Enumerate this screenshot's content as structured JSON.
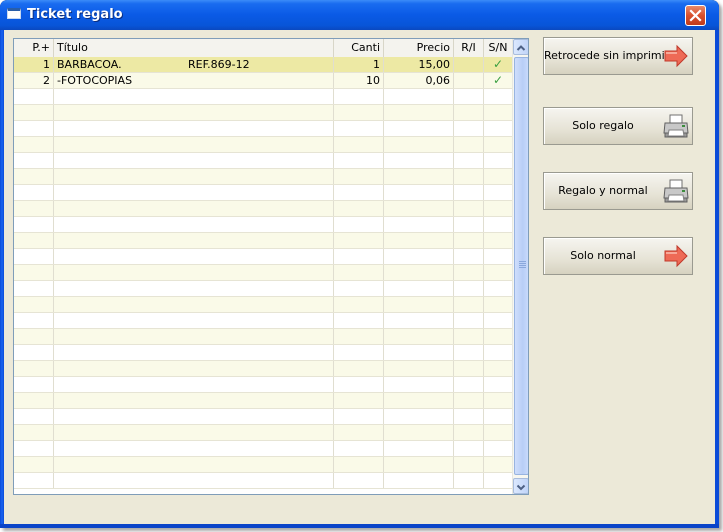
{
  "window": {
    "title": "Ticket regalo"
  },
  "grid": {
    "columns": [
      "P.+",
      "Título",
      "Canti",
      "Precio",
      "R/I",
      "S/N"
    ],
    "rows": [
      {
        "p": "1",
        "titulo": "BARBACOA.",
        "ref": "REF.869-12",
        "canti": "1",
        "precio": "15,00",
        "ri": "",
        "sn": "✓"
      },
      {
        "p": "2",
        "titulo": "-FOTOCOPIAS",
        "ref": "",
        "canti": "10",
        "precio": "0,06",
        "ri": "",
        "sn": "✓"
      }
    ],
    "selected_row": 0
  },
  "buttons": {
    "retrocede": {
      "label": "Retrocede sin imprimir",
      "icon": "red-arrow-icon"
    },
    "solo_regalo": {
      "label": "Solo regalo",
      "icon": "printer-icon"
    },
    "regalo_normal": {
      "label": "Regalo y normal",
      "icon": "printer-icon"
    },
    "solo_normal": {
      "label": "Solo normal",
      "icon": "red-arrow-icon"
    }
  },
  "colors": {
    "title_bar": "#0a5ae6",
    "selected_row": "#ede9a4",
    "check": "#3aa040",
    "arrow": "#e85a4a"
  }
}
